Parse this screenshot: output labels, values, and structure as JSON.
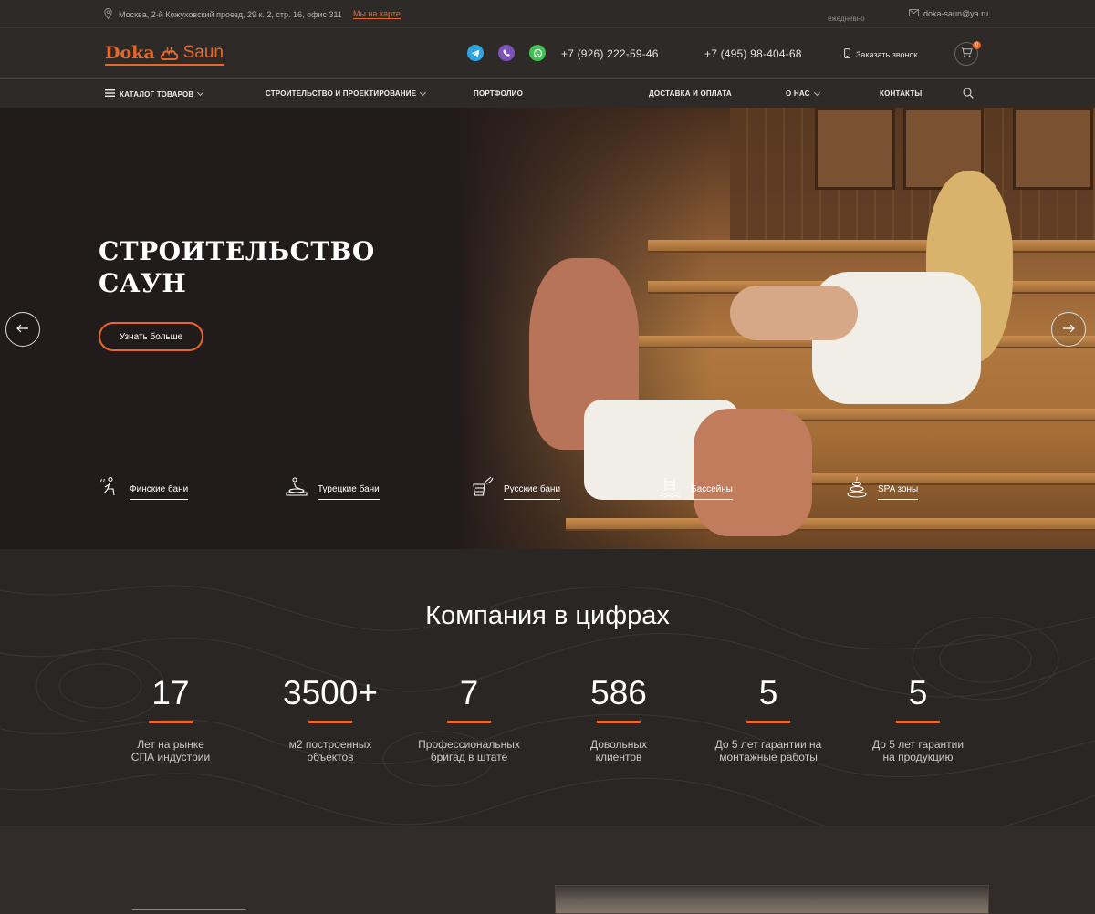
{
  "topbar": {
    "address": "Москва, 2-й Кожуховский проезд, 29 к. 2, стр. 16, офис 311",
    "map_link": "Мы на карте",
    "hours": "ежедневно",
    "email": "doka-saun@ya.ru"
  },
  "header": {
    "logo_part1": "Doka",
    "logo_part2": "Saun",
    "phone1": "+7 (926) 222-59-46",
    "phone2": "+7 (495) 98-404-68",
    "callback": "Заказать звонок",
    "cart_count": "0",
    "social": [
      {
        "name": "telegram-icon",
        "color": "#2ea5e0"
      },
      {
        "name": "viber-icon",
        "color": "#7c52b9"
      },
      {
        "name": "whatsapp-icon",
        "color": "#3fc155"
      }
    ]
  },
  "nav": {
    "items": [
      {
        "label": "КАТАЛОГ ТОВАРОВ"
      },
      {
        "label": "СТРОИТЕЛЬСТВО И ПРОЕКТИРОВАНИЕ"
      },
      {
        "label": "ПОРТФОЛИО"
      },
      {
        "label": "ДОСТАВКА И ОПЛАТА"
      },
      {
        "label": "О НАС"
      },
      {
        "label": "КОНТАКТЫ"
      }
    ]
  },
  "hero": {
    "title_line1": "СТРОИТЕЛЬСТВО",
    "title_line2": "САУН",
    "button": "Узнать больше",
    "categories": [
      {
        "label": "Финские бани",
        "icon": "sauna-person-icon"
      },
      {
        "label": "Турецкие бани",
        "icon": "massage-icon"
      },
      {
        "label": "Русские бани",
        "icon": "bucket-broom-icon"
      },
      {
        "label": "Бассейны",
        "icon": "pool-ladder-icon"
      },
      {
        "label": "SPA зоны",
        "icon": "spa-stones-icon"
      }
    ]
  },
  "stats": {
    "title": "Компания в цифрах",
    "items": [
      {
        "value": "17",
        "line1": "Лет на рынке",
        "line2": "СПА индустрии"
      },
      {
        "value": "3500+",
        "line1": "м2 построенных",
        "line2": "объектов"
      },
      {
        "value": "7",
        "line1": "Профессиональных",
        "line2": "бригад в штате"
      },
      {
        "value": "586",
        "line1": "Довольных",
        "line2": "клиентов"
      },
      {
        "value": "5",
        "line1": "До 5 лет гарантии на",
        "line2": "монтажные работы"
      },
      {
        "value": "5",
        "line1": "До 5 лет гарантии",
        "line2": "на продукцию"
      }
    ]
  },
  "colors": {
    "accent": "#e7672a",
    "background": "#2b2725"
  }
}
